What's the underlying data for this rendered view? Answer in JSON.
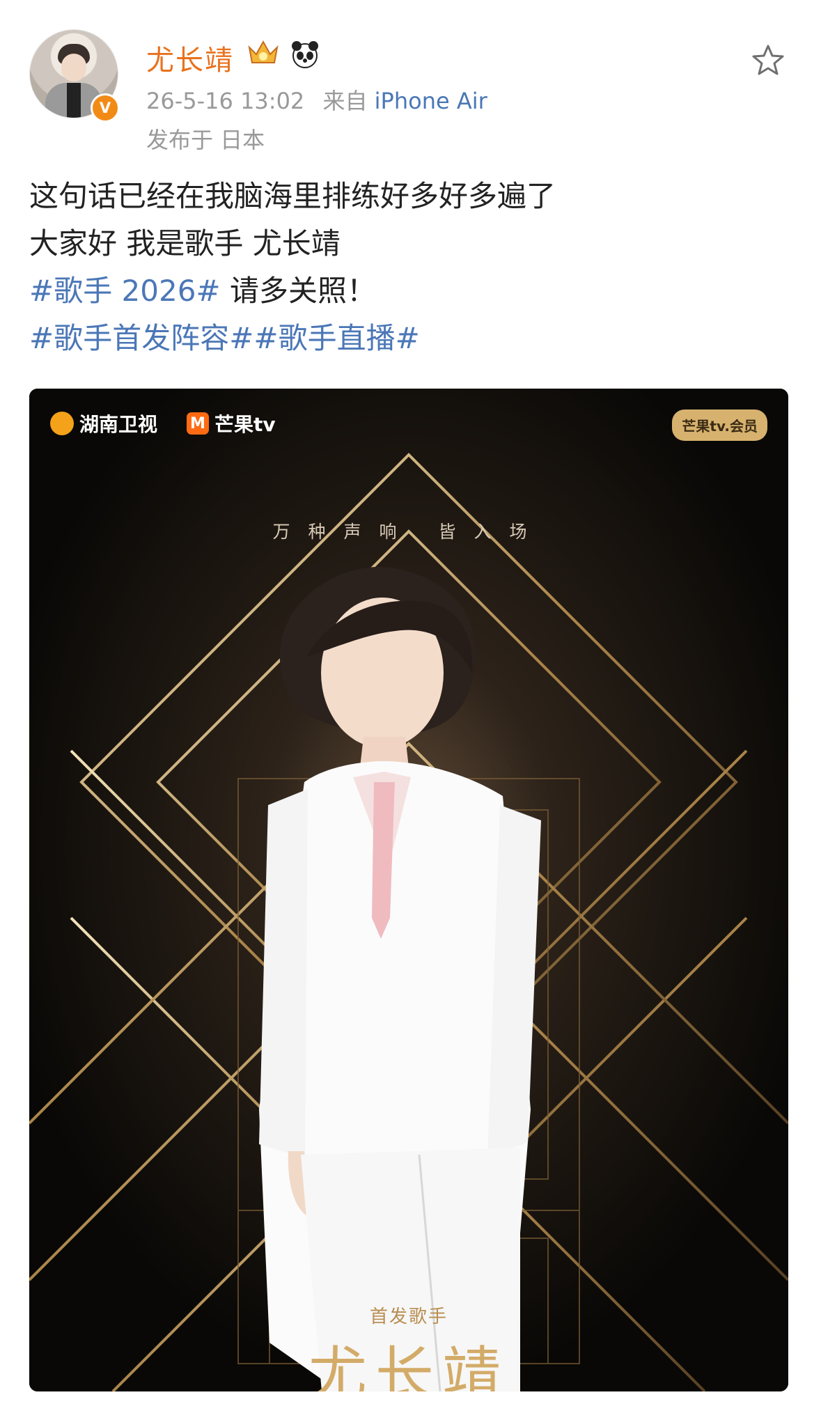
{
  "post": {
    "user_name": "尤长靖",
    "verified_badge": "V",
    "timestamp": "26-5-16 13:02",
    "source_prefix": "来自",
    "device": "iPhone Air",
    "location": "发布于 日本",
    "text_lines": [
      "这句话已经在我脑海里排练好多好多遍了",
      "大家好 我是歌手 尤长靖"
    ],
    "hashtag_line_1": {
      "tag": "#歌手 2026#",
      "text": " 请多关照！"
    },
    "hashtag_line_2": [
      "#歌手首发阵容#",
      "#歌手直播#"
    ]
  },
  "poster": {
    "logos": [
      "湖南卫视",
      "芒果tv"
    ],
    "logo_box_text": "M",
    "vip_text": "芒果tv.会员",
    "slogan": "万种声响  皆入场",
    "bottom_label": "首发歌手",
    "bottom_name": "尤长靖"
  },
  "icons": {
    "star": "star-icon",
    "crown": "crown-icon",
    "panda": "panda-icon"
  },
  "colors": {
    "username": "#e9711c",
    "hashtag": "#4b77b7",
    "meta": "#999999",
    "poster_bg": "#0d0b09",
    "gold": "#d3ab68"
  }
}
